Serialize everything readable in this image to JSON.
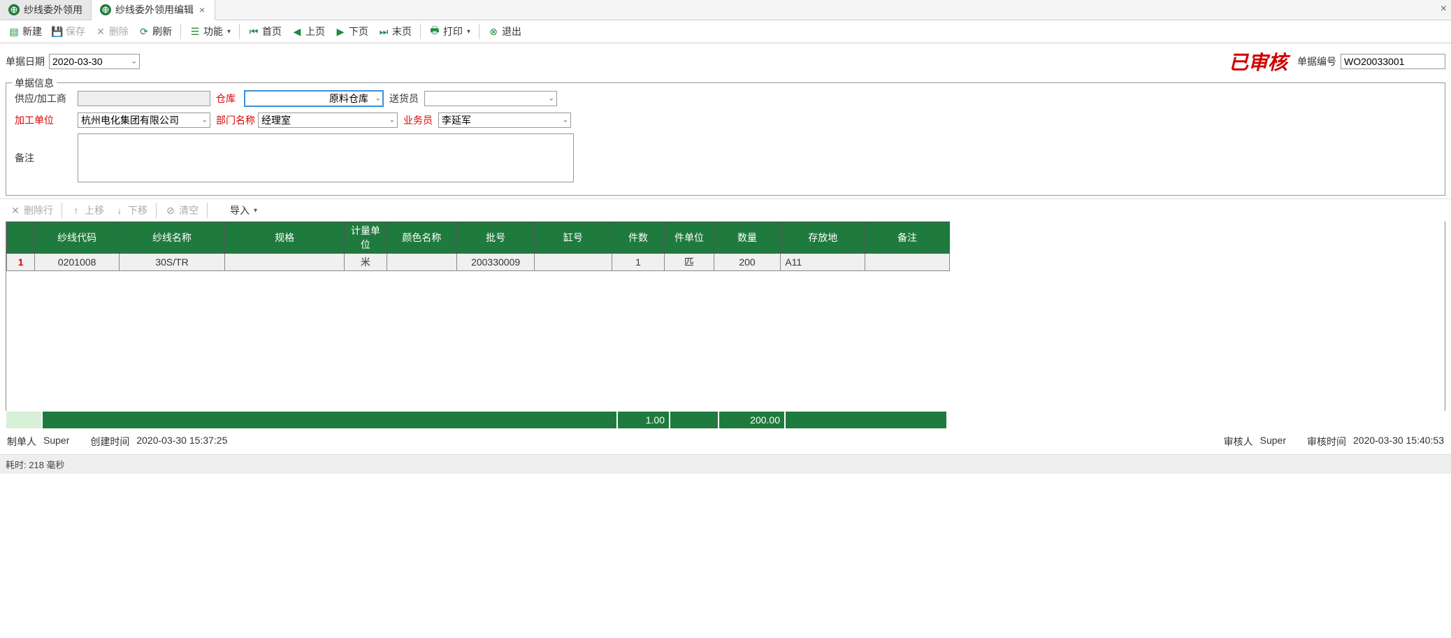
{
  "tabs": [
    {
      "label": "纱线委外领用"
    },
    {
      "label": "纱线委外领用编辑"
    }
  ],
  "toolbar": {
    "new": "新建",
    "save": "保存",
    "delete": "删除",
    "refresh": "刷新",
    "func": "功能",
    "first": "首页",
    "prev": "上页",
    "next": "下页",
    "last": "末页",
    "print": "打印",
    "exit": "退出"
  },
  "doc": {
    "date_label": "单据日期",
    "date_value": "2020-03-30",
    "approved_stamp": "已审核",
    "docnum_label": "单据编号",
    "docnum_value": "WO20033001"
  },
  "fieldset": {
    "legend": "单据信息",
    "supplier_label": "供应/加工商",
    "supplier_value": "",
    "warehouse_label": "仓库",
    "warehouse_value": "原料仓库",
    "deliverer_label": "送货员",
    "deliverer_value": "",
    "processor_label": "加工单位",
    "processor_value": "杭州电化集团有限公司",
    "dept_label": "部门名称",
    "dept_value": "经理室",
    "salesman_label": "业务员",
    "salesman_value": "李延军",
    "remark_label": "备注",
    "remark_value": ""
  },
  "gridbar": {
    "delrow": "删除行",
    "moveup": "上移",
    "movedown": "下移",
    "clear": "清空",
    "import": "导入"
  },
  "grid": {
    "headers": [
      "纱线代码",
      "纱线名称",
      "规格",
      "计量单位",
      "颜色名称",
      "批号",
      "缸号",
      "件数",
      "件单位",
      "数量",
      "存放地",
      "备注"
    ],
    "rows": [
      {
        "n": "1",
        "code": "0201008",
        "name": "30S/TR",
        "spec": "",
        "unit": "米",
        "color": "",
        "batch": "200330009",
        "vat": "",
        "pieces": "1",
        "pieceunit": "匹",
        "qty": "200",
        "loc": "A11",
        "remark": ""
      }
    ],
    "totals": {
      "pieces": "1.00",
      "qty": "200.00"
    }
  },
  "footer": {
    "creator_label": "制单人",
    "creator": "Super",
    "createtime_label": "创建时间",
    "createtime": "2020-03-30 15:37:25",
    "auditor_label": "审核人",
    "auditor": "Super",
    "audittime_label": "审核时间",
    "audittime": "2020-03-30 15:40:53"
  },
  "status": {
    "elapsed_label": "耗时:",
    "elapsed_value": "218 毫秒"
  }
}
